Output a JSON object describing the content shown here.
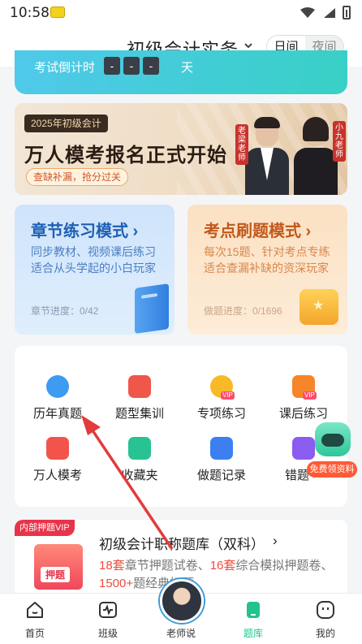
{
  "status_bar": {
    "time": "10:58"
  },
  "header": {
    "exam_title": "初级会计实务",
    "mode_toggle": {
      "day": "日间",
      "night": "夜间"
    }
  },
  "countdown": {
    "label": "考试倒计时",
    "digits": [
      "-",
      "-",
      "-"
    ],
    "unit": "天"
  },
  "promo": {
    "tag": "2025年初级会计",
    "title": "万人模考报名正式开始",
    "button": "查缺补漏，抢分过关",
    "teachers": [
      {
        "name": "老梁老师"
      },
      {
        "name": "小九老师"
      }
    ]
  },
  "mode_cards": [
    {
      "title": "章节练习模式 ›",
      "desc_line1": "同步教材、视频课后练习",
      "desc_line2": "适合从头学起的小白玩家",
      "progress": "章节进度：0/42"
    },
    {
      "title": "考点刷题模式 ›",
      "desc_line1": "每次15题、针对考点专练",
      "desc_line2": "适合查漏补缺的资深玩家",
      "progress": "做题进度：0/1696"
    }
  ],
  "tools": [
    {
      "label": "历年真题",
      "icon": "past-exams-icon",
      "color": "#3d9bf2",
      "vip": ""
    },
    {
      "label": "题型集训",
      "icon": "question-type-icon",
      "color": "#f0574a",
      "vip": ""
    },
    {
      "label": "专项练习",
      "icon": "special-practice-icon",
      "color": "#f7b928",
      "vip": "VIP"
    },
    {
      "label": "课后练习",
      "icon": "after-class-icon",
      "color": "#f7852a",
      "vip": "VIP"
    },
    {
      "label": "万人模考",
      "icon": "mock-exam-icon",
      "color": "#f2544c",
      "vip": ""
    },
    {
      "label": "收藏夹",
      "icon": "favorites-icon",
      "color": "#27c392",
      "vip": ""
    },
    {
      "label": "做题记录",
      "icon": "records-icon",
      "color": "#3b7ff0",
      "vip": ""
    },
    {
      "label": "错题",
      "icon": "wrong-questions-icon",
      "color": "#8a5cf0",
      "vip": ""
    }
  ],
  "gift": {
    "label": "免费领资料"
  },
  "bank_card": {
    "tag": "内部押题VIP",
    "cover_text": "押题",
    "title": "初级会计职称题库（双科）",
    "arrow": "›",
    "desc_parts": [
      "18套",
      "章节押题试卷、",
      "16套",
      "综合模拟押题卷、",
      "1500+",
      "题",
      "经典好题"
    ]
  },
  "bottom_nav": [
    {
      "label": "首页",
      "icon": "home-icon"
    },
    {
      "label": "班级",
      "icon": "class-icon"
    },
    {
      "label": "老师说",
      "icon": "teacher-avatar"
    },
    {
      "label": "题库",
      "icon": "question-bank-icon"
    },
    {
      "label": "我的",
      "icon": "profile-icon"
    }
  ],
  "colors": {
    "accent": "#22c38e",
    "highlight": "#ef4b3c",
    "annotation_arrow": "#e23b3b"
  }
}
